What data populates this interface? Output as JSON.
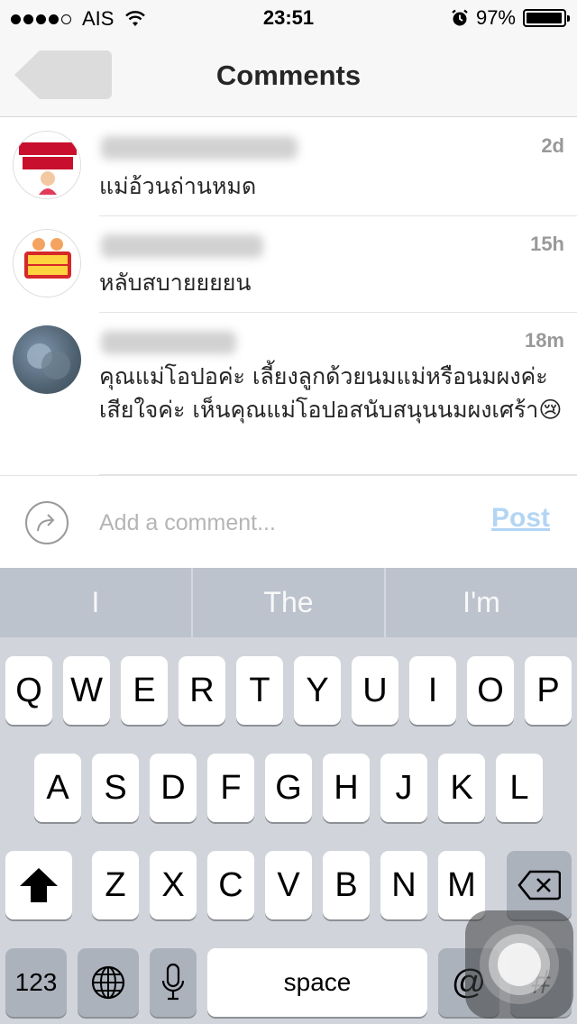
{
  "status_bar": {
    "carrier": "AIS",
    "time": "23:51",
    "battery_text": "97%",
    "battery_level": 0.97
  },
  "nav": {
    "title": "Comments",
    "back_icon": "back-arrow-icon"
  },
  "comments": [
    {
      "username": "plussize_bigsale",
      "time": "2d",
      "text": "แม่อ้วนถ่านหมด",
      "avatar": "bigsize-logo"
    },
    {
      "username": "tottybooks99",
      "time": "15h",
      "text": "หลับสบายยยยน",
      "avatar": "totty-books-logo"
    },
    {
      "username": "kingkarn08",
      "time": "18m",
      "text": "คุณแม่โอปอค่ะ เลี้ยงลูกด้วยนมแม่หรือนมผงค่ะ เสียใจค่ะ เห็นคุณแม่โอปอสนับสนุนนมผงเศร้า😢",
      "avatar": "user-photo"
    }
  ],
  "composer": {
    "placeholder": "Add a comment...",
    "post_label": "Post",
    "post_color": "#b3d5f5"
  },
  "keyboard": {
    "suggestions": [
      "I",
      "The",
      "I'm"
    ],
    "row1": [
      "Q",
      "W",
      "E",
      "R",
      "T",
      "Y",
      "U",
      "I",
      "O",
      "P"
    ],
    "row2": [
      "A",
      "S",
      "D",
      "F",
      "G",
      "H",
      "J",
      "K",
      "L"
    ],
    "row3": [
      "Z",
      "X",
      "C",
      "V",
      "B",
      "N",
      "M"
    ],
    "numbers_label": "123",
    "space_label": "space",
    "at_label": "@",
    "hash_label": "#"
  }
}
